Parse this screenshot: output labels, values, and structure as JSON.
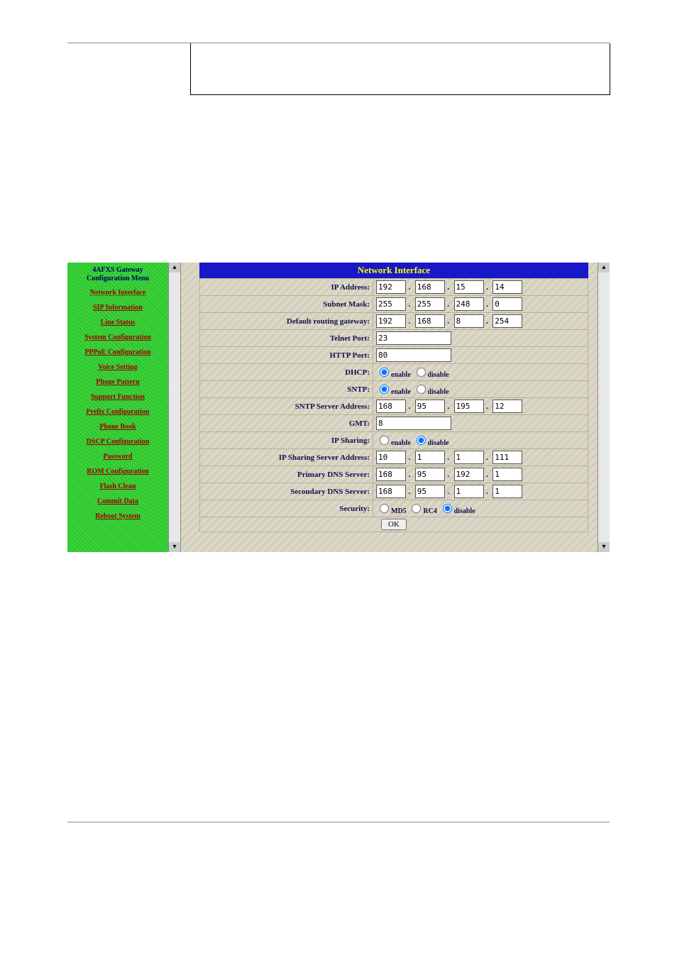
{
  "sidebar": {
    "title_line1": "4AFXS Gateway",
    "title_line2": "Configuration Menu",
    "items": [
      {
        "label": "Network Interface"
      },
      {
        "label": "SIP Information"
      },
      {
        "label": "Line Status"
      },
      {
        "label": "System Configuration"
      },
      {
        "label": "PPPoE Configuration"
      },
      {
        "label": "Voice Setting"
      },
      {
        "label": "Phone Pattern"
      },
      {
        "label": "Support Function"
      },
      {
        "label": "Prefix Configuration"
      },
      {
        "label": "Phone Book"
      },
      {
        "label": "DSCP Configuration"
      },
      {
        "label": "Password"
      },
      {
        "label": "ROM Configuration"
      },
      {
        "label": "Flash Clean"
      },
      {
        "label": "Commit Data"
      },
      {
        "label": "Reboot System"
      }
    ]
  },
  "panel": {
    "title": "Network Interface",
    "rows": {
      "ip": {
        "label": "IP Address:",
        "v": [
          "192",
          "168",
          "15",
          "14"
        ]
      },
      "mask": {
        "label": "Subnet Mask:",
        "v": [
          "255",
          "255",
          "248",
          "0"
        ]
      },
      "gw": {
        "label": "Default routing gateway:",
        "v": [
          "192",
          "168",
          "8",
          "254"
        ]
      },
      "telnet": {
        "label": "Telnet Port:",
        "v": "23"
      },
      "http": {
        "label": "HTTP Port:",
        "v": "80"
      },
      "dhcp": {
        "label": "DHCP:",
        "enable": "enable",
        "disable": "disable"
      },
      "sntp": {
        "label": "SNTP:",
        "enable": "enable",
        "disable": "disable"
      },
      "sntpaddr": {
        "label": "SNTP Server Address:",
        "v": [
          "168",
          "95",
          "195",
          "12"
        ]
      },
      "gmt": {
        "label": "GMT:",
        "v": "8"
      },
      "ipsharing": {
        "label": "IP Sharing:",
        "enable": "enable",
        "disable": "disable"
      },
      "ipshaddr": {
        "label": "IP Sharing Server Address:",
        "v": [
          "10",
          "1",
          "1",
          "111"
        ]
      },
      "dns1": {
        "label": "Primary DNS Server:",
        "v": [
          "168",
          "95",
          "192",
          "1"
        ]
      },
      "dns2": {
        "label": "Secondary DNS Server:",
        "v": [
          "168",
          "95",
          "1",
          "1"
        ]
      },
      "security": {
        "label": "Security:",
        "md5": "MD5",
        "rc4": "RC4",
        "disable": "disable"
      }
    },
    "ok": "OK"
  }
}
